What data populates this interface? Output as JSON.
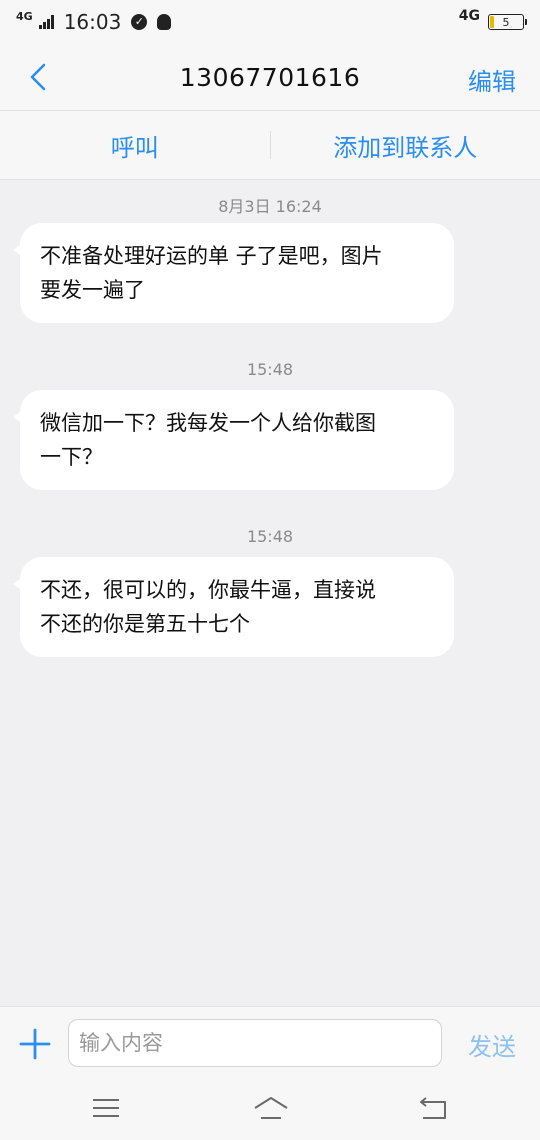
{
  "status_bar": {
    "network": "4G",
    "time": "16:03",
    "notification_glyph": "✓",
    "network_right": "4G",
    "battery_level": "5"
  },
  "header": {
    "title": "13067701616",
    "edit_label": "编辑"
  },
  "actions": {
    "call_label": "呼叫",
    "add_contact_label": "添加到联系人"
  },
  "messages": [
    {
      "timestamp": "8月3日 16:24",
      "lines": [
        "不准备处理好运的单 子了是吧，图片",
        "要发一遍了"
      ]
    },
    {
      "timestamp": "15:48",
      "lines": [
        "微信加一下？我每发一个人给你截图",
        "一下？"
      ]
    },
    {
      "timestamp": "15:48",
      "lines": [
        "不还，很可以的，你最牛逼，直接说",
        "不还的你是第五十七个"
      ]
    }
  ],
  "composer": {
    "placeholder": "输入内容",
    "send_label": "发送"
  },
  "colors": {
    "accent": "#2a8ef0",
    "send_disabled": "#8ec0f2",
    "background": "#f0f0f2",
    "bubble": "#ffffff"
  }
}
